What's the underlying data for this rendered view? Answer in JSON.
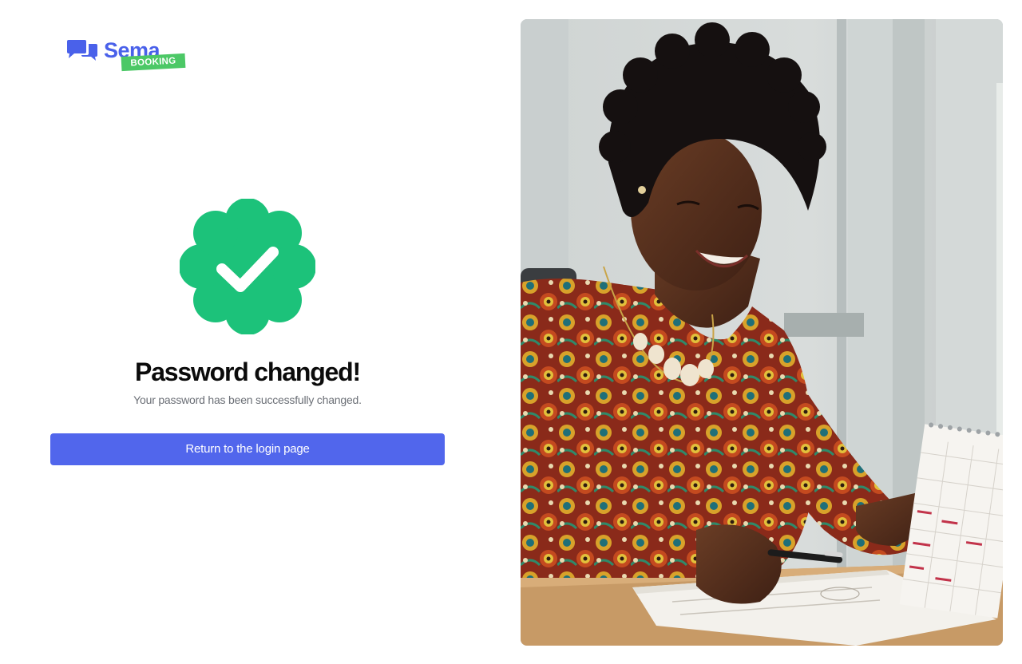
{
  "brand": {
    "name": "Sema",
    "tag": "BOOKING",
    "primary_color": "#4a61ea",
    "tag_color": "#4cc866",
    "icon": "chat-bubbles-icon"
  },
  "status": {
    "icon": "verified-check-badge-icon",
    "badge_color": "#1cc27a",
    "title": "Password changed!",
    "message": "Your password has been successfully changed."
  },
  "actions": {
    "return_label": "Return to the login page",
    "button_color": "#5166ec"
  },
  "hero": {
    "image": "woman-with-calendar-photo"
  }
}
